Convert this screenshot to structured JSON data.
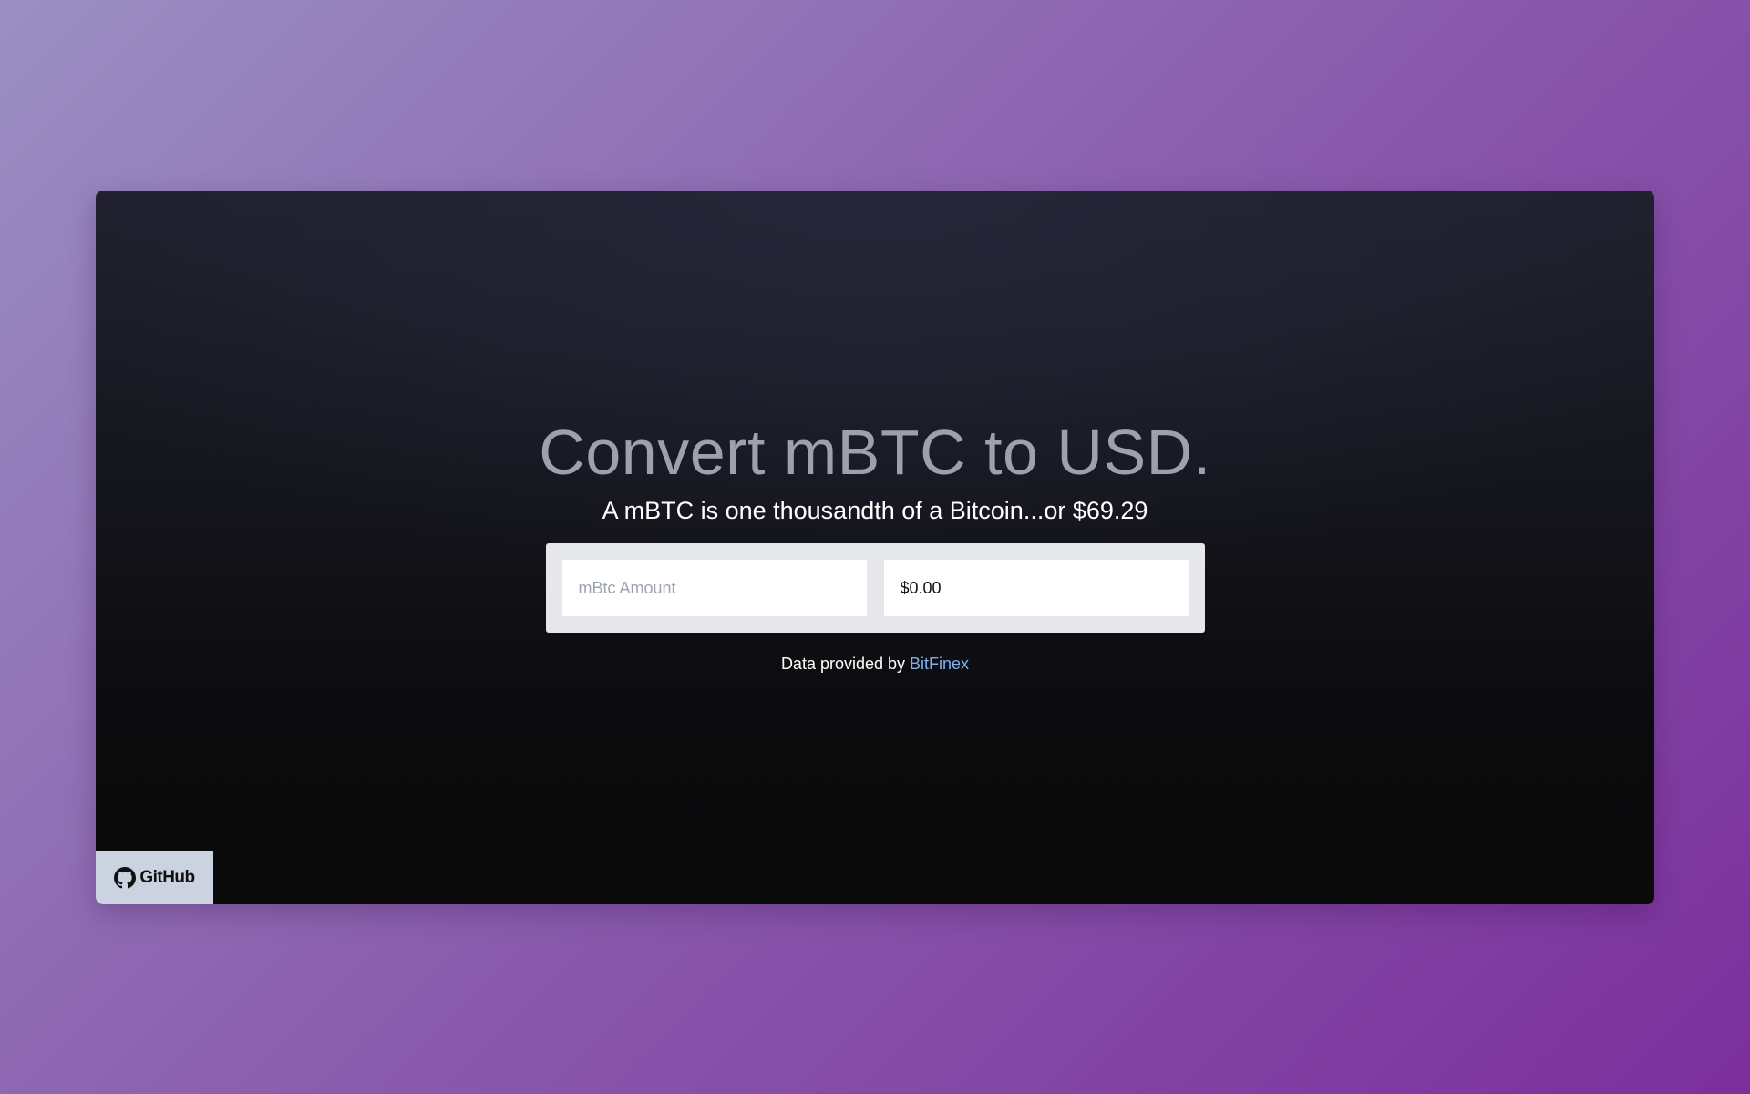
{
  "page": {
    "title": "Convert mBTC to USD.",
    "subtitle": "A mBTC is one thousandth of a Bitcoin...or $69.29"
  },
  "converter": {
    "mbtc_placeholder": "mBtc Amount",
    "mbtc_value": "",
    "usd_value": "$0.00"
  },
  "credit": {
    "prefix": "Data provided by ",
    "link_label": "BitFinex"
  },
  "github": {
    "label": "GitHub",
    "icon": "github-icon"
  },
  "colors": {
    "background_start": "#9a8fc2",
    "background_end": "#7b2f9c",
    "card_top": "#262639",
    "card_bottom": "#0a0a0a",
    "title": "#9ca1ad",
    "link": "#7fb0ee",
    "converter_bg": "#e5e7eb",
    "github_bg": "#cbd3e0"
  }
}
